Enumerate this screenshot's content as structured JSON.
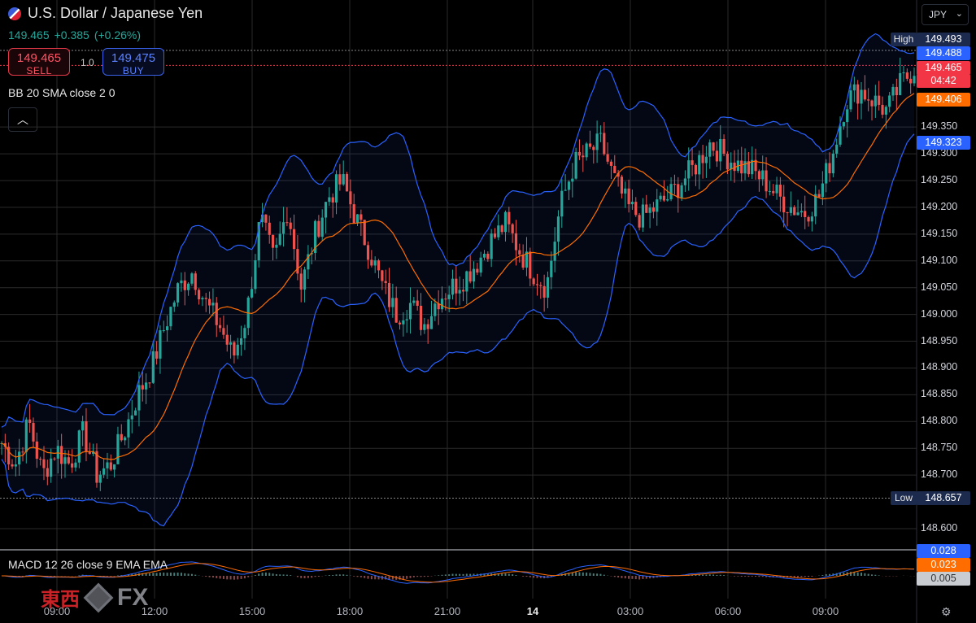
{
  "header": {
    "title": "U.S. Dollar / Japanese Yen",
    "last": "149.465",
    "change": "+0.385",
    "change_pct": "(+0.26%)"
  },
  "trade": {
    "sell_price": "149.465",
    "sell_label": "SELL",
    "lot": "1.0",
    "buy_price": "149.475",
    "buy_label": "BUY"
  },
  "indicators": {
    "bb_label": "BB 20 SMA close 2 0",
    "macd_label": "MACD 12 26 close 9 EMA EMA"
  },
  "currency_select": "JPY",
  "price_axis": {
    "ticks": [
      "149.350",
      "149.300",
      "149.250",
      "149.200",
      "149.150",
      "149.100",
      "149.050",
      "149.000",
      "148.950",
      "148.900",
      "148.850",
      "148.800",
      "148.750",
      "148.700",
      "148.600"
    ],
    "high_label": "High",
    "high_value": "149.493",
    "low_label": "Low",
    "low_value": "148.657",
    "upper_band": "149.488",
    "last_price": "149.465",
    "countdown": "04:42",
    "middle_band": "149.406",
    "lower_band": "149.323"
  },
  "macd_axis": {
    "macd": "0.028",
    "signal": "0.023",
    "hist": "0.005"
  },
  "time_axis": [
    "09:00",
    "12:00",
    "15:00",
    "18:00",
    "21:00",
    "14",
    "03:00",
    "06:00",
    "09:00"
  ],
  "logo": {
    "text": "東西",
    "suffix": "FX"
  },
  "colors": {
    "up": "#26a69a",
    "down": "#ef5350",
    "band": "#2962ff",
    "basis": "#ff6d00",
    "bg": "#000000",
    "grid": "#2a2a2a"
  },
  "chart_data": {
    "type": "candlestick",
    "title": "U.S. Dollar / Japanese Yen",
    "y_range": [
      148.56,
      149.5
    ],
    "series": [
      {
        "name": "BB 20 SMA close 2 0",
        "upper": "149.488",
        "basis": "149.406",
        "lower": "149.323"
      },
      {
        "name": "MACD 12 26 close 9 EMA EMA",
        "macd": "0.028",
        "signal": "0.023",
        "histogram": "0.005"
      }
    ],
    "close_path": [
      148.76,
      148.72,
      148.8,
      148.7,
      148.75,
      148.72,
      148.78,
      148.7,
      148.72,
      148.78,
      148.85,
      148.9,
      148.98,
      149.05,
      149.08,
      149.02,
      148.98,
      148.92,
      149.0,
      149.18,
      149.1,
      149.2,
      149.05,
      149.15,
      149.22,
      149.25,
      149.18,
      149.12,
      149.05,
      149.0,
      149.02,
      148.98,
      149.03,
      149.05,
      149.07,
      149.1,
      149.14,
      149.17,
      149.12,
      149.08,
      149.05,
      149.2,
      149.28,
      149.3,
      149.32,
      149.25,
      149.2,
      149.18,
      149.2,
      149.22,
      149.25,
      149.28,
      149.32,
      149.3,
      149.28,
      149.27,
      149.25,
      149.22,
      149.2,
      149.19,
      149.22,
      149.3,
      149.4,
      149.42,
      149.4,
      149.38,
      149.43,
      149.46
    ]
  }
}
